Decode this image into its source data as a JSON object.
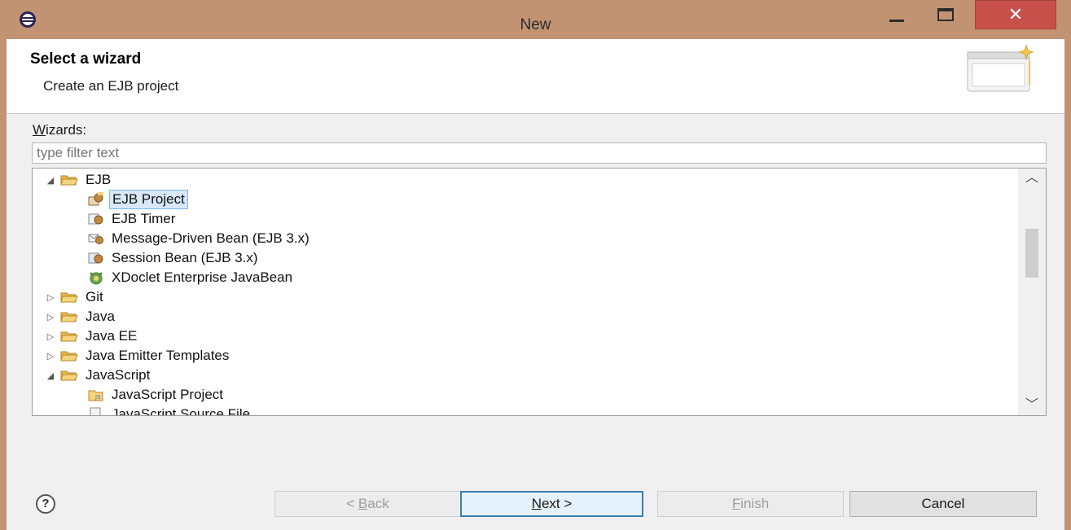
{
  "window": {
    "title": "New",
    "close_glyph": "✕"
  },
  "header": {
    "title": "Select a wizard",
    "description": "Create an EJB project"
  },
  "wizards_label": {
    "accel": "W",
    "rest": "izards:"
  },
  "filter": {
    "placeholder": "type filter text",
    "value": ""
  },
  "tree": {
    "items": [
      {
        "label": "EJB",
        "kind": "folder",
        "expanded": true
      },
      {
        "label": "EJB Project",
        "kind": "item",
        "icon": "ejb-project-icon",
        "selected": true
      },
      {
        "label": "EJB Timer",
        "kind": "item",
        "icon": "ejb-timer-icon"
      },
      {
        "label": "Message-Driven Bean (EJB 3.x)",
        "kind": "item",
        "icon": "message-bean-icon"
      },
      {
        "label": "Session Bean (EJB 3.x)",
        "kind": "item",
        "icon": "session-bean-icon"
      },
      {
        "label": "XDoclet Enterprise JavaBean",
        "kind": "item",
        "icon": "xdoclet-icon"
      },
      {
        "label": "Git",
        "kind": "folder",
        "expanded": false
      },
      {
        "label": "Java",
        "kind": "folder",
        "expanded": false
      },
      {
        "label": "Java EE",
        "kind": "folder",
        "expanded": false
      },
      {
        "label": "Java Emitter Templates",
        "kind": "folder",
        "expanded": false
      },
      {
        "label": "JavaScript",
        "kind": "folder",
        "expanded": true
      },
      {
        "label": "JavaScript Project",
        "kind": "item",
        "icon": "javascript-project-icon"
      },
      {
        "label": "JavaScript Source File",
        "kind": "item",
        "icon": "javascript-file-icon"
      }
    ],
    "twisty_expanded": "◢",
    "twisty_collapsed": "▷"
  },
  "scrollbar": {
    "up_glyph": "︿",
    "down_glyph": "﹀"
  },
  "help": {
    "glyph": "?"
  },
  "buttons": {
    "back": {
      "accel": "B",
      "prefix": "< ",
      "rest": "ack"
    },
    "next": {
      "accel": "N",
      "rest": "ext >"
    },
    "finish": {
      "accel": "F",
      "rest": "inish"
    },
    "cancel": {
      "label": "Cancel"
    }
  }
}
